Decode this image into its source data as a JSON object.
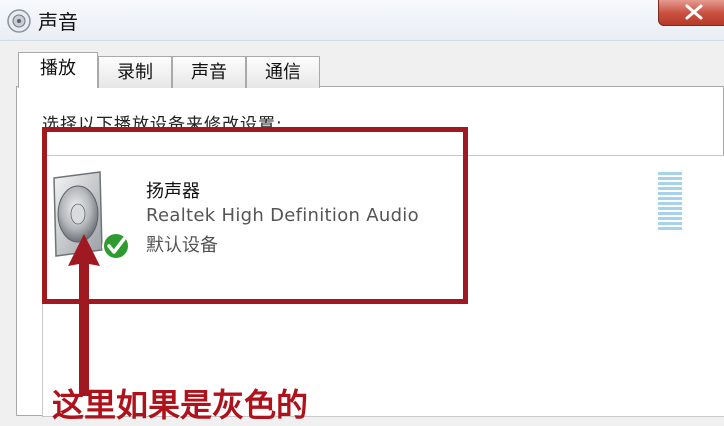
{
  "window": {
    "title": "声音"
  },
  "tabs": [
    {
      "label": "播放"
    },
    {
      "label": "录制"
    },
    {
      "label": "声音"
    },
    {
      "label": "通信"
    }
  ],
  "playback": {
    "instruction": "选择以下播放设备来修改设置:",
    "devices": [
      {
        "name": "扬声器",
        "description": "Realtek High Definition Audio",
        "status": "默认设备",
        "icon": "speaker-icon",
        "badge": "check-icon"
      }
    ]
  },
  "annotation": {
    "text": "这里如果是灰色的",
    "color": "#b0121b"
  }
}
